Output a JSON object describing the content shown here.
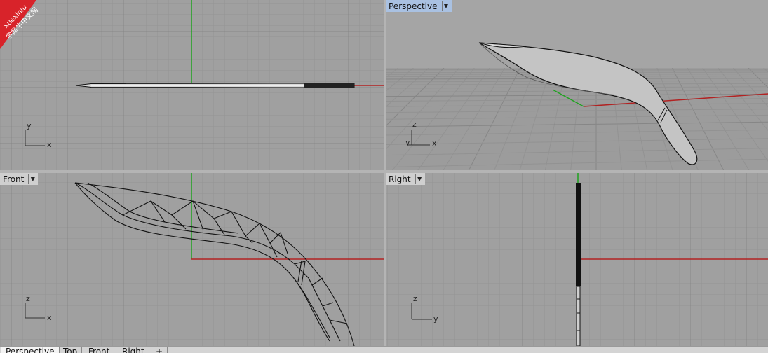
{
  "watermark": {
    "line1": "xuexiniu",
    "line2": "学犀牛中文网",
    "color": "#d8232a"
  },
  "viewports": {
    "top": {
      "name": "Top",
      "axis_y": "y",
      "axis_x": "x"
    },
    "perspective": {
      "label": "Perspective",
      "axis_z": "z",
      "axis_y": "y",
      "axis_x": "x"
    },
    "front": {
      "label": "Front",
      "axis_z": "z",
      "axis_x": "x"
    },
    "right": {
      "label": "Right",
      "axis_z": "z",
      "axis_y": "y"
    }
  },
  "tabs": [
    "Perspective",
    "Top",
    "Front",
    "Right",
    "+"
  ],
  "colors": {
    "grid_bg": "#a0a0a0",
    "grid_line": "#959595",
    "grid_major": "#8a8a8a",
    "x_axis": "#b22222",
    "y_axis": "#1fa31f",
    "active_label": "#a9c1e2"
  },
  "icons": {
    "dropdown": "chevron-down-icon",
    "new_tab": "plus-icon"
  }
}
